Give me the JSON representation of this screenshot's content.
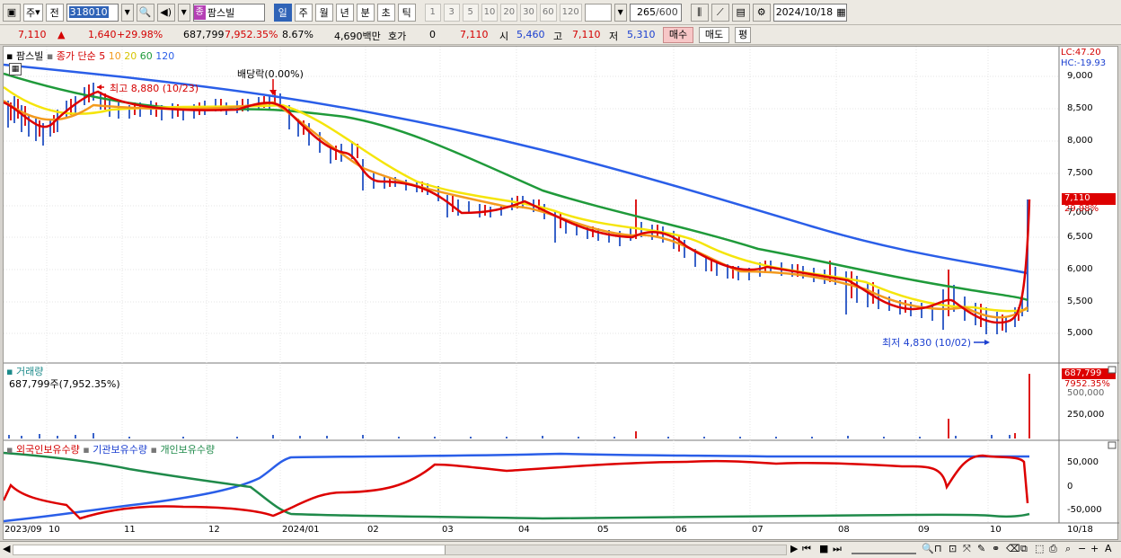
{
  "toolbar": {
    "market": "주",
    "prev": "전",
    "code": "318010",
    "stock_name_tag": "종",
    "stock_name": "팜스빌",
    "periods": [
      "일",
      "주",
      "월",
      "년",
      "분",
      "초",
      "틱"
    ],
    "active_period": "일",
    "intervals": [
      "1",
      "3",
      "5",
      "10",
      "20",
      "30",
      "60",
      "120"
    ],
    "count": "265",
    "count_total": "/600",
    "date": "2024/10/18"
  },
  "quote": {
    "price": "7,110",
    "change": "1,640",
    "change_pct": "+29.98%",
    "volume": "687,799",
    "volume_pct": "7,952.35%",
    "turnover": "8.67%",
    "amount": "4,690백만",
    "hoga_label": "호가",
    "hoga": "0",
    "hoga_price": "7,110",
    "open_label": "시",
    "open": "5,460",
    "high_label": "고",
    "high": "7,110",
    "low_label": "저",
    "low": "5,310",
    "buy": "매수",
    "sell": "매도",
    "avg": "평"
  },
  "price_panel": {
    "title": "팜스빌",
    "ma_label": "종가 단순",
    "ma_periods": [
      "5",
      "10",
      "20",
      "60",
      "120"
    ],
    "ma_colors": [
      "#dd0000",
      "#f39a1e",
      "#f5e50b",
      "#1f9a3a",
      "#2a5ee8"
    ],
    "lc": "LC:47.20",
    "hc": "HC:-19.93",
    "high_annotation": "최고 8,880 (10/23)",
    "low_annotation": "최저 4,830 (10/02)",
    "dividend_annotation": "배당락(0.00%)",
    "price_tag": "7,110",
    "price_tag_pct": "29.98%",
    "y_ticks": [
      "9,000",
      "8,500",
      "8,000",
      "7,500",
      "7,000",
      "6,500",
      "6,000",
      "5,500",
      "5,000"
    ]
  },
  "volume_panel": {
    "title": "거래량",
    "summary": "687,799주(7,952.35%)",
    "tag": "687,799",
    "tag_pct": "7952.35%",
    "y_ticks": [
      "500,000",
      "250,000"
    ]
  },
  "holdings_panel": {
    "series": [
      "외국인보유수량",
      "기관보유수량",
      "개인보유수량"
    ],
    "colors": [
      "#dd0000",
      "#2a5ee8",
      "#1f8a4a"
    ],
    "y_ticks": [
      "50,000",
      "0",
      "-50,000"
    ]
  },
  "x_axis": {
    "labels": [
      "2023/09",
      "10",
      "11",
      "12",
      "2024/01",
      "02",
      "03",
      "04",
      "05",
      "06",
      "07",
      "08",
      "09",
      "10"
    ],
    "last_date": "10/18"
  },
  "chart_data": {
    "type": "line",
    "title": "팜스빌",
    "x": [
      "2023/09",
      "10",
      "11",
      "12",
      "2024/01",
      "02",
      "03",
      "04",
      "05",
      "06",
      "07",
      "08",
      "09",
      "10",
      "10/18"
    ],
    "ylim": [
      4800,
      9200
    ],
    "series": [
      {
        "name": "5",
        "values": [
          8550,
          8500,
          8450,
          8480,
          8650,
          7600,
          7100,
          6950,
          6650,
          6600,
          6100,
          6000,
          5500,
          5200,
          7110
        ]
      },
      {
        "name": "120",
        "values": [
          9100,
          8950,
          8800,
          8750,
          8700,
          8450,
          8250,
          8050,
          7750,
          7450,
          7100,
          6700,
          6300,
          6050,
          5950
        ]
      }
    ],
    "volume": {
      "last": 687799
    },
    "high": {
      "value": 8880,
      "date": "10/23"
    },
    "low": {
      "value": 4830,
      "date": "10/02"
    }
  }
}
